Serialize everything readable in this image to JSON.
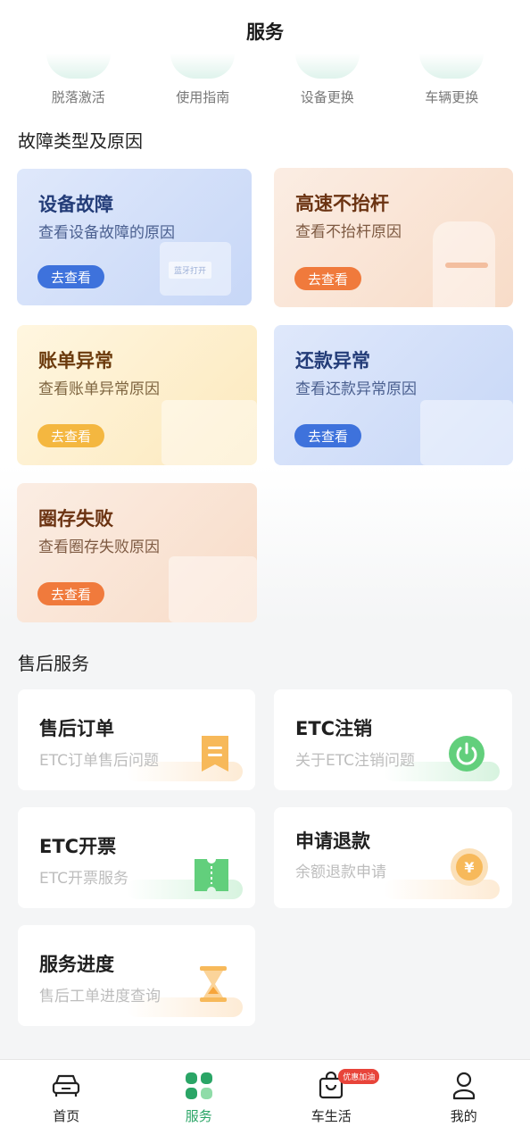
{
  "header": {
    "title": "服务"
  },
  "quick_links": [
    {
      "label": "脱落激活",
      "icon": "activation-icon"
    },
    {
      "label": "使用指南",
      "icon": "guide-icon"
    },
    {
      "label": "设备更换",
      "icon": "device-replace-icon"
    },
    {
      "label": "车辆更换",
      "icon": "vehicle-replace-icon"
    }
  ],
  "fault_section": {
    "title": "故障类型及原因",
    "cards": [
      {
        "title": "设备故障",
        "subtitle": "查看设备故障的原因",
        "button": "去查看",
        "deco_text": "蓝牙打开"
      },
      {
        "title": "高速不抬杆",
        "subtitle": "查看不抬杆原因",
        "button": "去查看"
      },
      {
        "title": "账单异常",
        "subtitle": "查看账单异常原因",
        "button": "去查看"
      },
      {
        "title": "还款异常",
        "subtitle": "查看还款异常原因",
        "button": "去查看"
      },
      {
        "title": "圈存失败",
        "subtitle": "查看圈存失败原因",
        "button": "去查看"
      }
    ]
  },
  "after_sales": {
    "title": "售后服务",
    "cards": [
      {
        "title": "售后订单",
        "subtitle": "ETC订单售后问题"
      },
      {
        "title": "ETC注销",
        "subtitle": "关于ETC注销问题"
      },
      {
        "title": "ETC开票",
        "subtitle": "ETC开票服务"
      },
      {
        "title": "申请退款",
        "subtitle": "余额退款申请"
      },
      {
        "title": "服务进度",
        "subtitle": "售后工单进度查询"
      }
    ]
  },
  "tabbar": {
    "tabs": [
      {
        "label": "首页",
        "icon": "car-icon"
      },
      {
        "label": "服务",
        "icon": "grid-icon",
        "active": true
      },
      {
        "label": "车生活",
        "icon": "shopping-bag-icon",
        "badge": "优惠加油"
      },
      {
        "label": "我的",
        "icon": "user-icon"
      }
    ]
  },
  "colors": {
    "accent": "#2aa566",
    "blue_button": "#3e72dc",
    "orange_button": "#f07a3c",
    "yellow_button": "#f4b740"
  }
}
